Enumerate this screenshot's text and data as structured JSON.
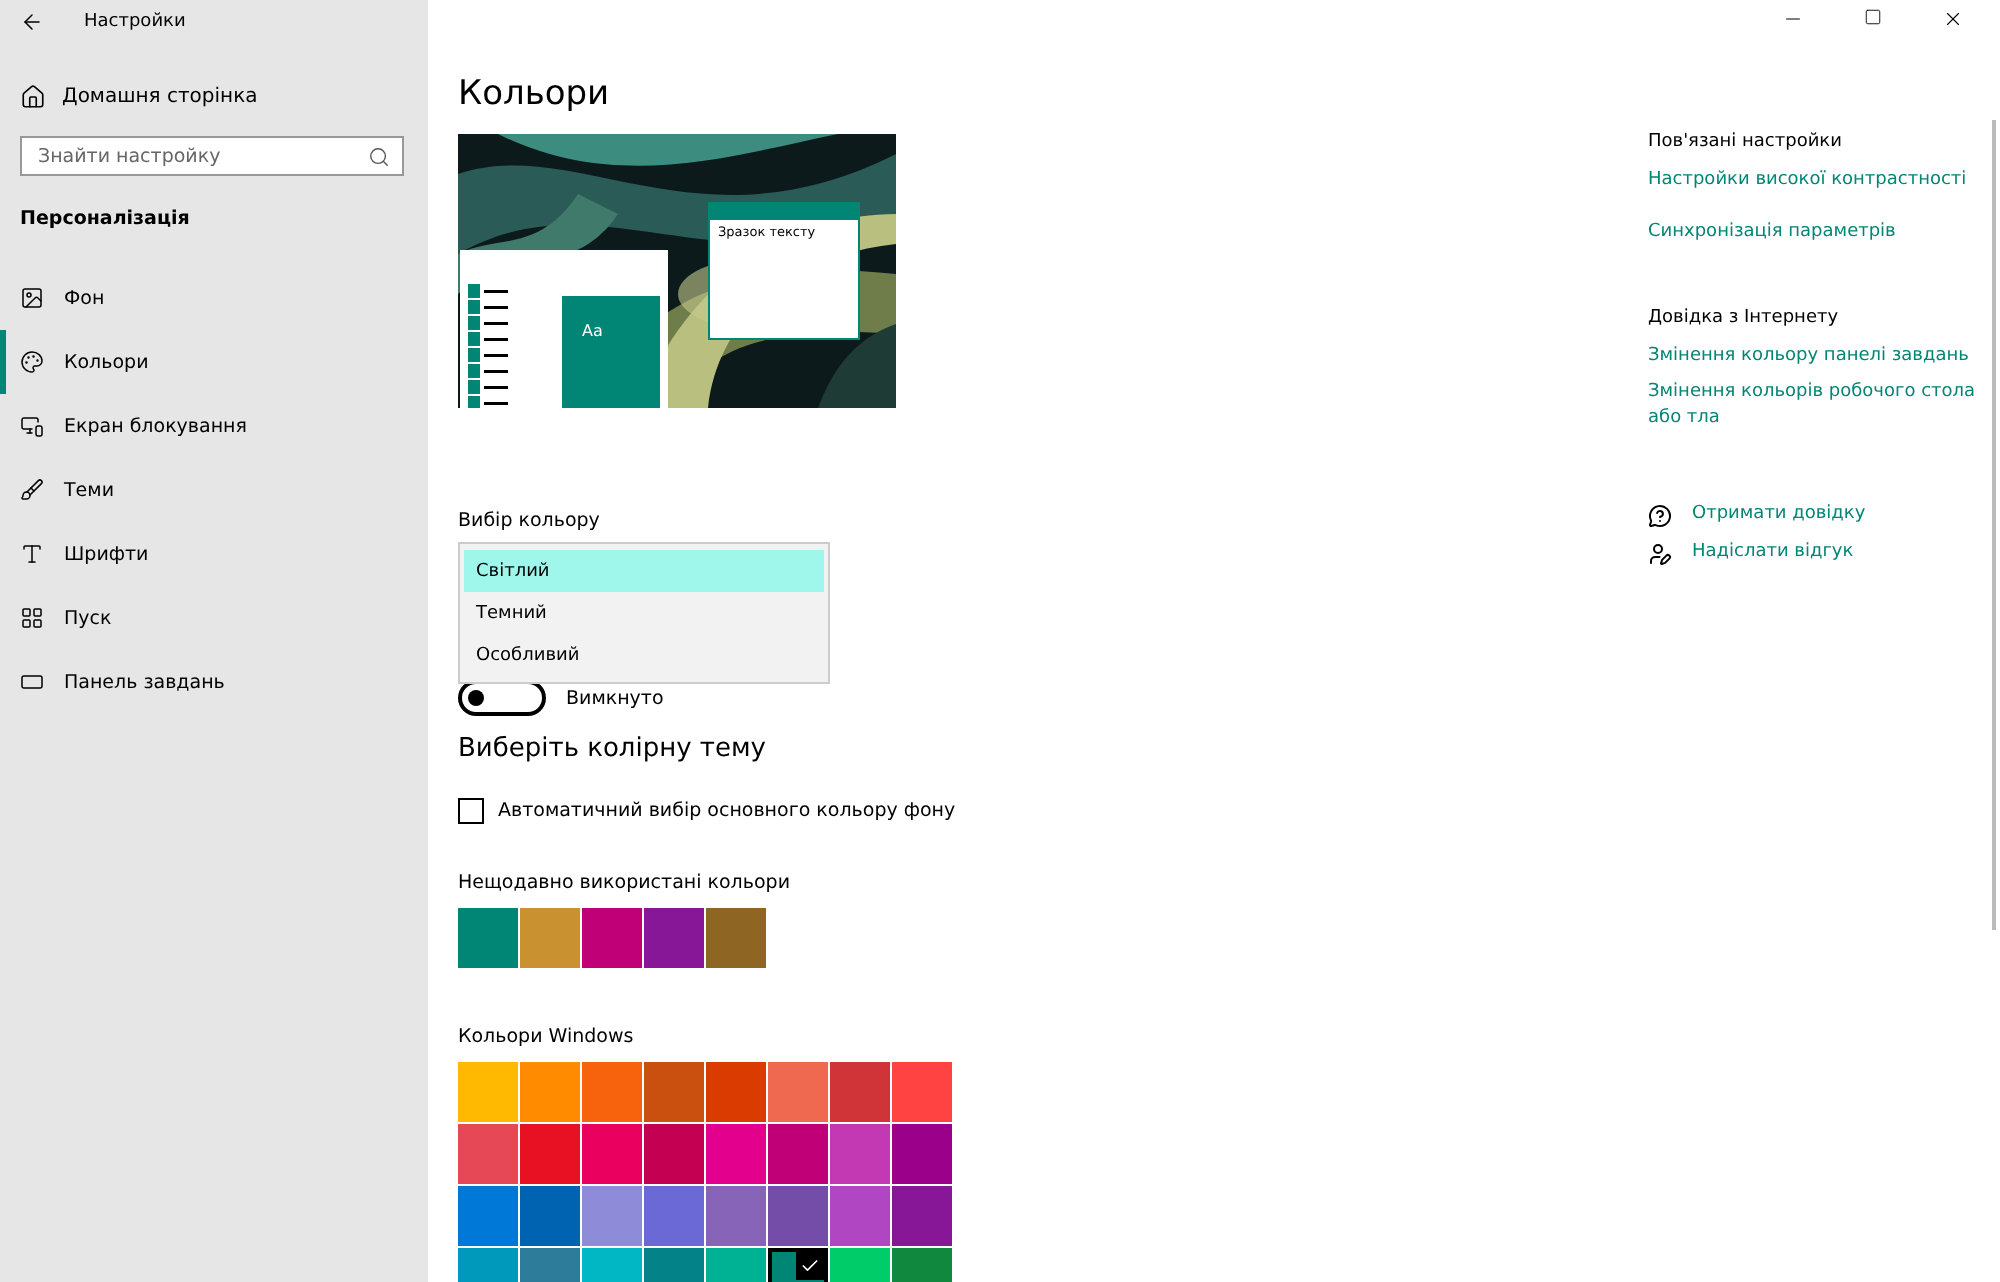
{
  "window": {
    "title": "Настройки"
  },
  "sidebar": {
    "home": "Домашня сторінка",
    "search": {
      "placeholder": "Знайти настройку"
    },
    "section": "Персоналізація",
    "items": [
      {
        "label": "Фон",
        "selected": false
      },
      {
        "label": "Кольори",
        "selected": true
      },
      {
        "label": "Екран блокування",
        "selected": false
      },
      {
        "label": "Теми",
        "selected": false
      },
      {
        "label": "Шрифти",
        "selected": false
      },
      {
        "label": "Пуск",
        "selected": false
      },
      {
        "label": "Панель завдань",
        "selected": false
      }
    ]
  },
  "page": {
    "title": "Кольори",
    "preview": {
      "sample_text": "Зразок тексту",
      "tile_text": "Aa"
    },
    "color_mode": {
      "label": "Вибір кольору",
      "options": [
        {
          "label": "Світлий",
          "selected": true
        },
        {
          "label": "Темний",
          "selected": false
        },
        {
          "label": "Особливий",
          "selected": false
        }
      ],
      "toggle": {
        "label": "Вимкнуто",
        "on": false
      }
    },
    "theme_heading": "Виберіть колірну тему",
    "auto_color": {
      "label": "Автоматичний вибір основного кольору фону",
      "checked": false
    },
    "recent_label": "Нещодавно використані кольори",
    "recent_colors": [
      {
        "color": "#018574"
      },
      {
        "color": "#ca9130"
      },
      {
        "color": "#bf0077"
      },
      {
        "color": "#881798"
      },
      {
        "color": "#8e6522"
      }
    ],
    "windows_label": "Кольори Windows",
    "windows_colors": [
      {
        "color": "#ffb900",
        "selected": false
      },
      {
        "color": "#ff8c00",
        "selected": false
      },
      {
        "color": "#f7630c",
        "selected": false
      },
      {
        "color": "#ca5010",
        "selected": false
      },
      {
        "color": "#da3b01",
        "selected": false
      },
      {
        "color": "#ef6950",
        "selected": false
      },
      {
        "color": "#d13438",
        "selected": false
      },
      {
        "color": "#ff4343",
        "selected": false
      },
      {
        "color": "#e74856",
        "selected": false
      },
      {
        "color": "#e81123",
        "selected": false
      },
      {
        "color": "#ea005e",
        "selected": false
      },
      {
        "color": "#c30052",
        "selected": false
      },
      {
        "color": "#e3008c",
        "selected": false
      },
      {
        "color": "#bf0077",
        "selected": false
      },
      {
        "color": "#c239b3",
        "selected": false
      },
      {
        "color": "#9a0089",
        "selected": false
      },
      {
        "color": "#0078d7",
        "selected": false
      },
      {
        "color": "#0063b1",
        "selected": false
      },
      {
        "color": "#8e8cd8",
        "selected": false
      },
      {
        "color": "#6b69d6",
        "selected": false
      },
      {
        "color": "#8764b8",
        "selected": false
      },
      {
        "color": "#744da9",
        "selected": false
      },
      {
        "color": "#b146c2",
        "selected": false
      },
      {
        "color": "#881798",
        "selected": false
      },
      {
        "color": "#0099bc",
        "selected": false
      },
      {
        "color": "#2d7d9a",
        "selected": false
      },
      {
        "color": "#00b7c3",
        "selected": false
      },
      {
        "color": "#038387",
        "selected": false
      },
      {
        "color": "#00b294",
        "selected": false
      },
      {
        "color": "#018574",
        "selected": true
      },
      {
        "color": "#00cc6a",
        "selected": false
      },
      {
        "color": "#10893e",
        "selected": false
      }
    ]
  },
  "related": {
    "heading": "Пов'язані настройки",
    "links": [
      "Настройки високої контрастності",
      "Синхронізація параметрів"
    ]
  },
  "web_help": {
    "heading": "Довідка з Інтернету",
    "links": [
      "Змінення кольору панелі завдань",
      "Змінення кольорів робочого стола або тла"
    ]
  },
  "support": [
    {
      "label": "Отримати довідку"
    },
    {
      "label": "Надіслати відгук"
    }
  ]
}
